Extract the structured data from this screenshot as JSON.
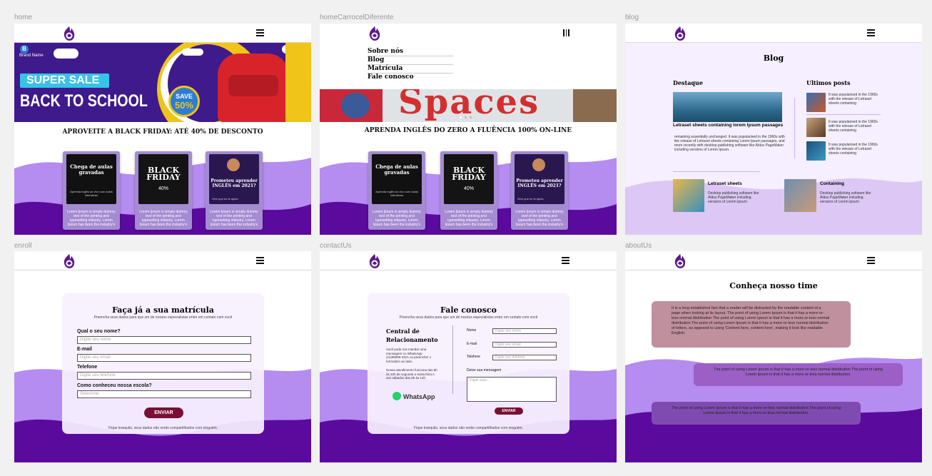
{
  "frames": {
    "home": "home",
    "carousel": "homeCarrocelDiferente",
    "blog": "blog",
    "enroll": "enroll",
    "contact": "contactUs",
    "about": "aboutUs"
  },
  "home": {
    "banner": {
      "brand": "B",
      "brand_name": "Brand Name",
      "super_sale": "SUPER SALE",
      "back_to_school": "BACK TO SCHOOL",
      "save": "SAVE",
      "save_pct": "50%"
    },
    "headline": "APROVEITE A BLACK FRIDAY: ATÉ 40% DE DESCONTO"
  },
  "cards": [
    {
      "title": "Chega de aulas gravadas",
      "sub": "Aprenda inglês ao vivo com aulas interativas",
      "text": "Lorem Ipsum is simply dummy text of the printing and typesetting industry. Lorem Ipsum has been the industry's"
    },
    {
      "title": "BLACK FRIDAY",
      "pct": "40%",
      "text": "Lorem Ipsum is simply dummy text of the printing and typesetting industry. Lorem Ipsum has been the industry's"
    },
    {
      "title": "Prometeu aprender INGLÊS em 2021?",
      "sub": "Vem que eu te ajudo",
      "text": "Lorem Ipsum is simply dummy text of the printing and typesetting industry. Lorem Ipsum has been the industry's"
    }
  ],
  "carousel": {
    "menu": [
      "Sobre nós",
      "Blog",
      "Matrícula",
      "Fale conosco"
    ],
    "banner_word": "Spaces",
    "headline": "APRENDA INGLÊS DO ZERO A FLUÊNCIA 100% ON-LINE"
  },
  "blog": {
    "title": "Blog",
    "featured_heading": "Destaque",
    "recent_heading": "Ultimos posts",
    "featured_title": "Letraset sheets containing lorem Ipsum passages",
    "featured_text": "remaining essentially unchanged. It was popularised in the 1960s with the release of Letraset sheets containing Lorem Ipsum passages, and more recently with desktop publishing software like Aldus PageMaker including versions of Lorem Ipsum.",
    "recent": [
      "It was popularised in the 1960s with the release of Letraset sheets containing",
      "It was popularised in the 1960s with the release of Letraset sheets containing",
      "It was popularised in the 1960s with the release of Letraset sheets containing"
    ],
    "bottom": [
      {
        "title": "Letraset sheets",
        "text": "Desktop publishing software like Aldus PageMaker including versions of Lorem Ipsum."
      },
      {
        "title": "Containing",
        "text": "Desktop publishing software like Aldus PageMaker including versions of Lorem Ipsum."
      }
    ]
  },
  "enroll": {
    "title": "Faça já a sua matrícula",
    "subtitle": "Preencha seus dados para que um de nossos especialistas entre em contato com você",
    "fields": [
      {
        "label": "Qual o seu nome?",
        "placeholder": "Digite seu nome"
      },
      {
        "label": "E-mail",
        "placeholder": "Digite seu email"
      },
      {
        "label": "Telefone",
        "placeholder": "Digite seu telefone"
      },
      {
        "label": "Como conheceu nossa escola?",
        "placeholder": "Selecione"
      }
    ],
    "button": "ENVIAR",
    "footer": "Fique tranquilo, seus dados não serão compartilhados com ninguém."
  },
  "contact": {
    "title": "Fale conosco",
    "subtitle": "Preencha seus dados para que um de nossos especialistas entre em contato com você",
    "central_title": "Central de Relacionamento",
    "central_text1": "Você pode nos mandar uma mensagem no WhatsApp (11)99999-4321 ou preencher o formulário ao lado.",
    "central_text2": "Nossa atendimento funciona das 8h às 22h de segunda a sexta feira e aos sábados das 8h às 14h.",
    "whatsapp": "WhatsApp",
    "fields": [
      {
        "label": "Nome",
        "placeholder": "Digite seu nome"
      },
      {
        "label": "E-mail",
        "placeholder": "Digite seu email"
      },
      {
        "label": "Telefone",
        "placeholder": "Digite seu telefone"
      }
    ],
    "message_label": "Deixe sua mensagem",
    "message_placeholder": "Digite aqui...",
    "button": "ENVIAR",
    "footer": "Fique tranquilo, seus dados não serão compartilhados com ninguém."
  },
  "about": {
    "title": "Conheça nosso time",
    "boxes": [
      "It is a long established fact that a reader will be distracted by the readable content of a page when looking at its layout. The point of using Lorem Ipsum is that it has a more-or-less normal distribution The point of using Lorem Ipsum is that it has a more-or-less normal distribution The point of using Lorem Ipsum is that it has a more-or-less normal distribution of letters, as opposed to using 'Content here, content here', making it look like readable English.",
      "The point of using Lorem Ipsum is that it has a more-or-less normal distribution The point of using Lorem Ipsum is that it has a more-or-less normal distribution.",
      "The point of using Lorem Ipsum is that it has a more-or-less normal distribution The point of using Lorem Ipsum is that it has a more-or-less normal distribution."
    ]
  },
  "colors": {
    "purple_dark": "#5b0a9e",
    "purple_light": "#b58cf0",
    "lavender": "#f5efff",
    "maroon": "#7a0f35"
  }
}
